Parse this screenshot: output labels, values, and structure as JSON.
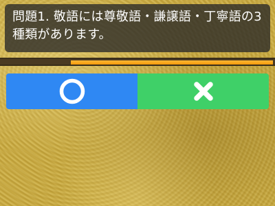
{
  "question": {
    "text": "問題1. 敬語には尊敬語・謙譲語・丁寧語の3種類があります。"
  },
  "progress": {
    "fraction_remaining": 0.74
  },
  "answers": {
    "true_icon": "circle-icon",
    "false_icon": "cross-icon"
  },
  "colors": {
    "true_button": "#2f88f3",
    "false_button": "#3fd068",
    "progress_fill": "#f7a31c",
    "question_box": "#282828"
  }
}
